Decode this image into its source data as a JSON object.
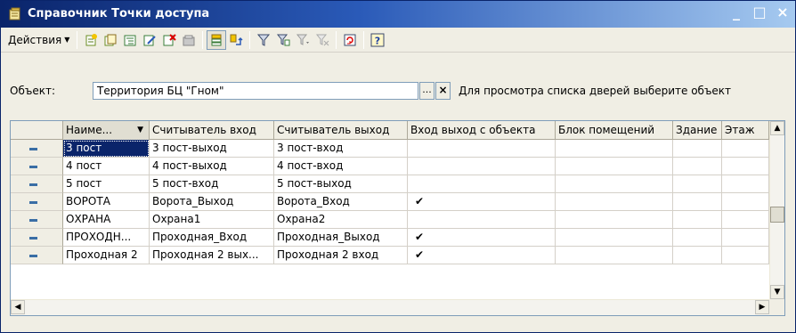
{
  "window": {
    "title": "Справочник Точки доступа",
    "controls": {
      "minimize": "_",
      "maximize": "□",
      "close": "×"
    }
  },
  "toolbar": {
    "actions_label": "Действия",
    "buttons": [
      "add-icon",
      "copy-icon",
      "add-group-icon",
      "edit-icon",
      "delete-icon",
      "mark-delete-icon",
      "hierarchy-icon",
      "level-up-icon",
      "filter-icon",
      "filter-by-value-icon",
      "filter-history-icon",
      "clear-filter-icon",
      "refresh-icon",
      "help-icon"
    ]
  },
  "object": {
    "label": "Объект:",
    "value": "Территория БЦ \"Гном\"",
    "pick_button": "...",
    "clear_button": "×",
    "hint": "Для просмотра списка дверей выберите объект"
  },
  "table": {
    "columns": [
      "Наиме...",
      "Считыватель вход",
      "Считыватель выход",
      "Вход выход с объекта",
      "Блок помещений",
      "Здание",
      "Этаж"
    ],
    "rows": [
      {
        "name": "3 пост",
        "reader_in": "3 пост-выход",
        "reader_out": "3 пост-вход",
        "in_out": "",
        "block": "",
        "building": "",
        "floor": ""
      },
      {
        "name": "4 пост",
        "reader_in": "4 пост-выход",
        "reader_out": "4 пост-вход",
        "in_out": "",
        "block": "",
        "building": "",
        "floor": ""
      },
      {
        "name": "5 пост",
        "reader_in": "5 пост-вход",
        "reader_out": "5 пост-выход",
        "in_out": "",
        "block": "",
        "building": "",
        "floor": ""
      },
      {
        "name": "ВОРОТА",
        "reader_in": "Ворота_Выход",
        "reader_out": "Ворота_Вход",
        "in_out": "✔",
        "block": "",
        "building": "",
        "floor": ""
      },
      {
        "name": "ОХРАНА",
        "reader_in": "Охрана1",
        "reader_out": "Охрана2",
        "in_out": "",
        "block": "",
        "building": "",
        "floor": ""
      },
      {
        "name": "ПРОХОДН...",
        "reader_in": "Проходная_Вход",
        "reader_out": "Проходная_Выход",
        "in_out": "✔",
        "block": "",
        "building": "",
        "floor": ""
      },
      {
        "name": "Проходная 2",
        "reader_in": "Проходная 2 вых...",
        "reader_out": "Проходная 2 вход",
        "in_out": "✔",
        "block": "",
        "building": "",
        "floor": ""
      }
    ]
  },
  "colors": {
    "titlebar_start": "#0A246A",
    "titlebar_end": "#A6CAF0",
    "selection": "#0A246A",
    "row_marker": "#3A6EA5"
  }
}
